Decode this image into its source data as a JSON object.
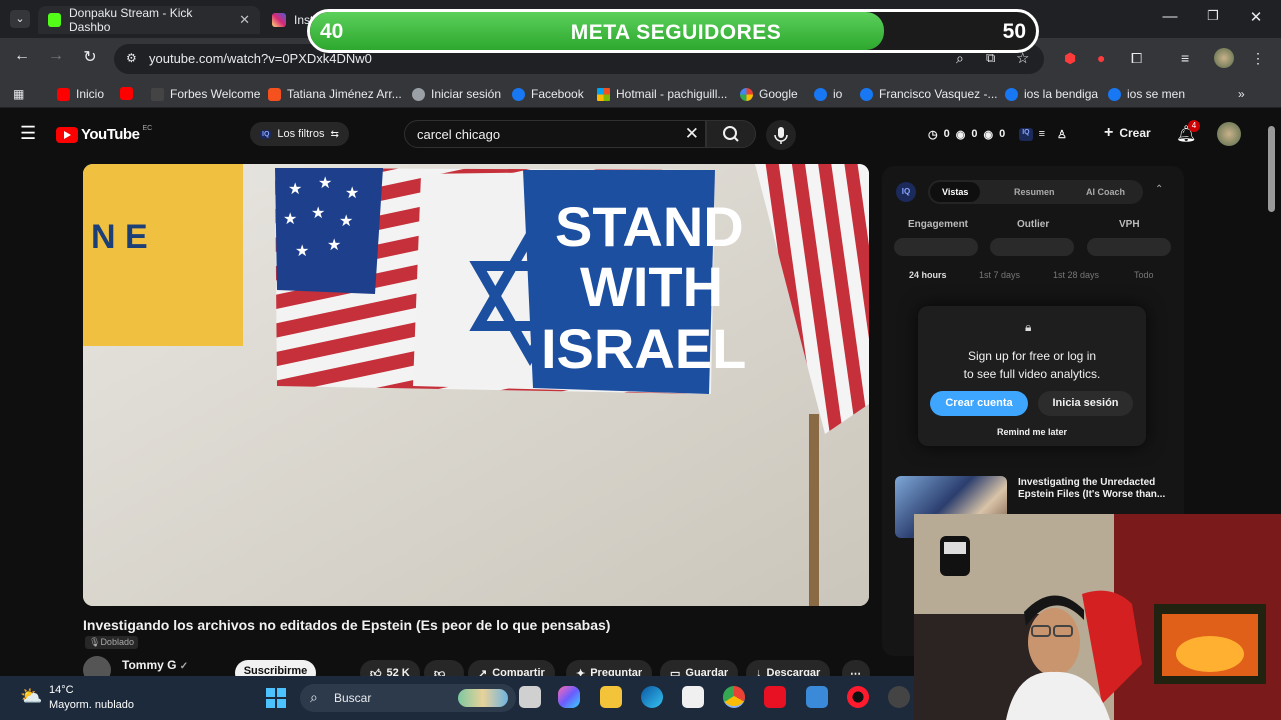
{
  "browser": {
    "tabs": [
      {
        "title": "Donpaku Stream - Kick Dashbo",
        "favicon": "kick-icon",
        "color": "#53fc18"
      },
      {
        "title": "Inst",
        "favicon": "instagram-icon",
        "color": "#e1306c"
      }
    ],
    "window_controls": {
      "minimize": "—",
      "restore": "❐",
      "close": "✕"
    },
    "tab_menu_glyph": "⌄",
    "url": "youtube.com/watch?v=0PXDxk4DNw0",
    "bookmarks": [
      {
        "label": "Inicio",
        "color": "#ff0000"
      },
      {
        "label": "",
        "color": "#ff0000"
      },
      {
        "label": "Forbes Welcome",
        "color": "#444444"
      },
      {
        "label": "Tatiana Jiménez Arr...",
        "color": "#f4511e"
      },
      {
        "label": "Iniciar sesión",
        "color": "#9aa0a6"
      },
      {
        "label": "Facebook",
        "color": "#1877f2"
      },
      {
        "label": "Hotmail - pachiguill...",
        "color": "#f25022"
      },
      {
        "label": "Google",
        "color": "#4285f4"
      },
      {
        "label": "io",
        "color": "#1877f2"
      },
      {
        "label": "Francisco Vasquez -...",
        "color": "#1877f2"
      },
      {
        "label": "ios la bendiga",
        "color": "#1877f2"
      },
      {
        "label": "ios se men",
        "color": "#1877f2"
      }
    ]
  },
  "goal_overlay": {
    "current": "40",
    "title": "META SEGUIDORES",
    "target": "50",
    "progress_fraction": 0.79,
    "fill_color": "#3dbb3d"
  },
  "youtube": {
    "logo_text": "YouTube",
    "country_code": "EC",
    "filters_label": "Los filtros",
    "search_query": "carcel chicago",
    "stats": [
      "0",
      "0",
      "0"
    ],
    "create_label": "Crear",
    "notification_count": "4",
    "video_title": "Investigando los archivos no editados de Epstein (Es peor de lo que pensabas)",
    "dub_label": "Doblado",
    "channel_name": "Tommy G",
    "subscribe_label": "Suscribirme",
    "likes": "52 K",
    "actions": {
      "share": "Compartir",
      "ask": "Preguntar",
      "save": "Guardar",
      "download": "Descargar"
    },
    "player_text": {
      "sign_letters": "N E",
      "stand_line1": "STAND",
      "stand_line2": "WITH",
      "stand_line3": "ISRAEL"
    }
  },
  "analytics_panel": {
    "logo": "IQ",
    "tabs": [
      "Vistas",
      "Resumen",
      "AI Coach"
    ],
    "active_tab": "Vistas",
    "metrics": [
      "Engagement",
      "Outlier",
      "VPH"
    ],
    "ranges": [
      "24 hours",
      "1st 7 days",
      "1st 28 days",
      "Todo"
    ],
    "active_range": "24 hours",
    "lock_message": "Sign up for free or log in\nto see full video analytics.",
    "create_account": "Crear cuenta",
    "login": "Inicia sesión",
    "remind": "Remind me later"
  },
  "recommendation": {
    "title": "Investigating the Unredacted Epstein Files (It's Worse than..."
  },
  "taskbar": {
    "temperature": "14°C",
    "weather": "Mayorm. nublado",
    "search_label": "Buscar"
  },
  "colors": {
    "youtube_red": "#ff0000",
    "accent_blue": "#3ea6ff",
    "taskbar_bg": "#1c2a3c"
  }
}
